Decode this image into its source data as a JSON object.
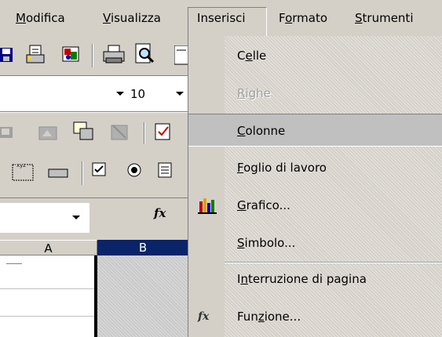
{
  "menubar": {
    "items": [
      {
        "pre": "",
        "acc": "M",
        "post": "odifica"
      },
      {
        "pre": "",
        "acc": "V",
        "post": "isualizza"
      },
      {
        "pre": "",
        "acc": "I",
        "post": "nserisci"
      },
      {
        "pre": "F",
        "acc": "o",
        "post": "rmato"
      },
      {
        "pre": "",
        "acc": "S",
        "post": "trumenti"
      }
    ]
  },
  "formatting": {
    "font_size": "10"
  },
  "formula_bar": {
    "fx_label": "fx"
  },
  "sheet": {
    "columns": [
      "A",
      "B"
    ],
    "selected_column": "B"
  },
  "dropdown": {
    "items": [
      {
        "pre": "C",
        "acc": "e",
        "post": "lle",
        "enabled": true,
        "hover": false,
        "icon": ""
      },
      {
        "pre": "",
        "acc": "R",
        "post": "ighe",
        "enabled": false,
        "hover": false,
        "icon": ""
      },
      {
        "pre": "",
        "acc": "C",
        "post": "olonne",
        "enabled": true,
        "hover": true,
        "icon": ""
      },
      {
        "pre": "",
        "acc": "F",
        "post": "oglio di lavoro",
        "enabled": true,
        "hover": false,
        "icon": ""
      },
      {
        "pre": "",
        "acc": "G",
        "post": "rafico...",
        "enabled": true,
        "hover": false,
        "icon": "chart-icon"
      },
      {
        "pre": "",
        "acc": "S",
        "post": "imbolo...",
        "enabled": true,
        "hover": false,
        "icon": ""
      },
      {
        "pre": "I",
        "acc": "n",
        "post": "terruzione di pagina",
        "enabled": true,
        "hover": false,
        "icon": ""
      },
      {
        "pre": "Fun",
        "acc": "z",
        "post": "ione...",
        "enabled": true,
        "hover": false,
        "icon": "function-icon"
      }
    ]
  }
}
